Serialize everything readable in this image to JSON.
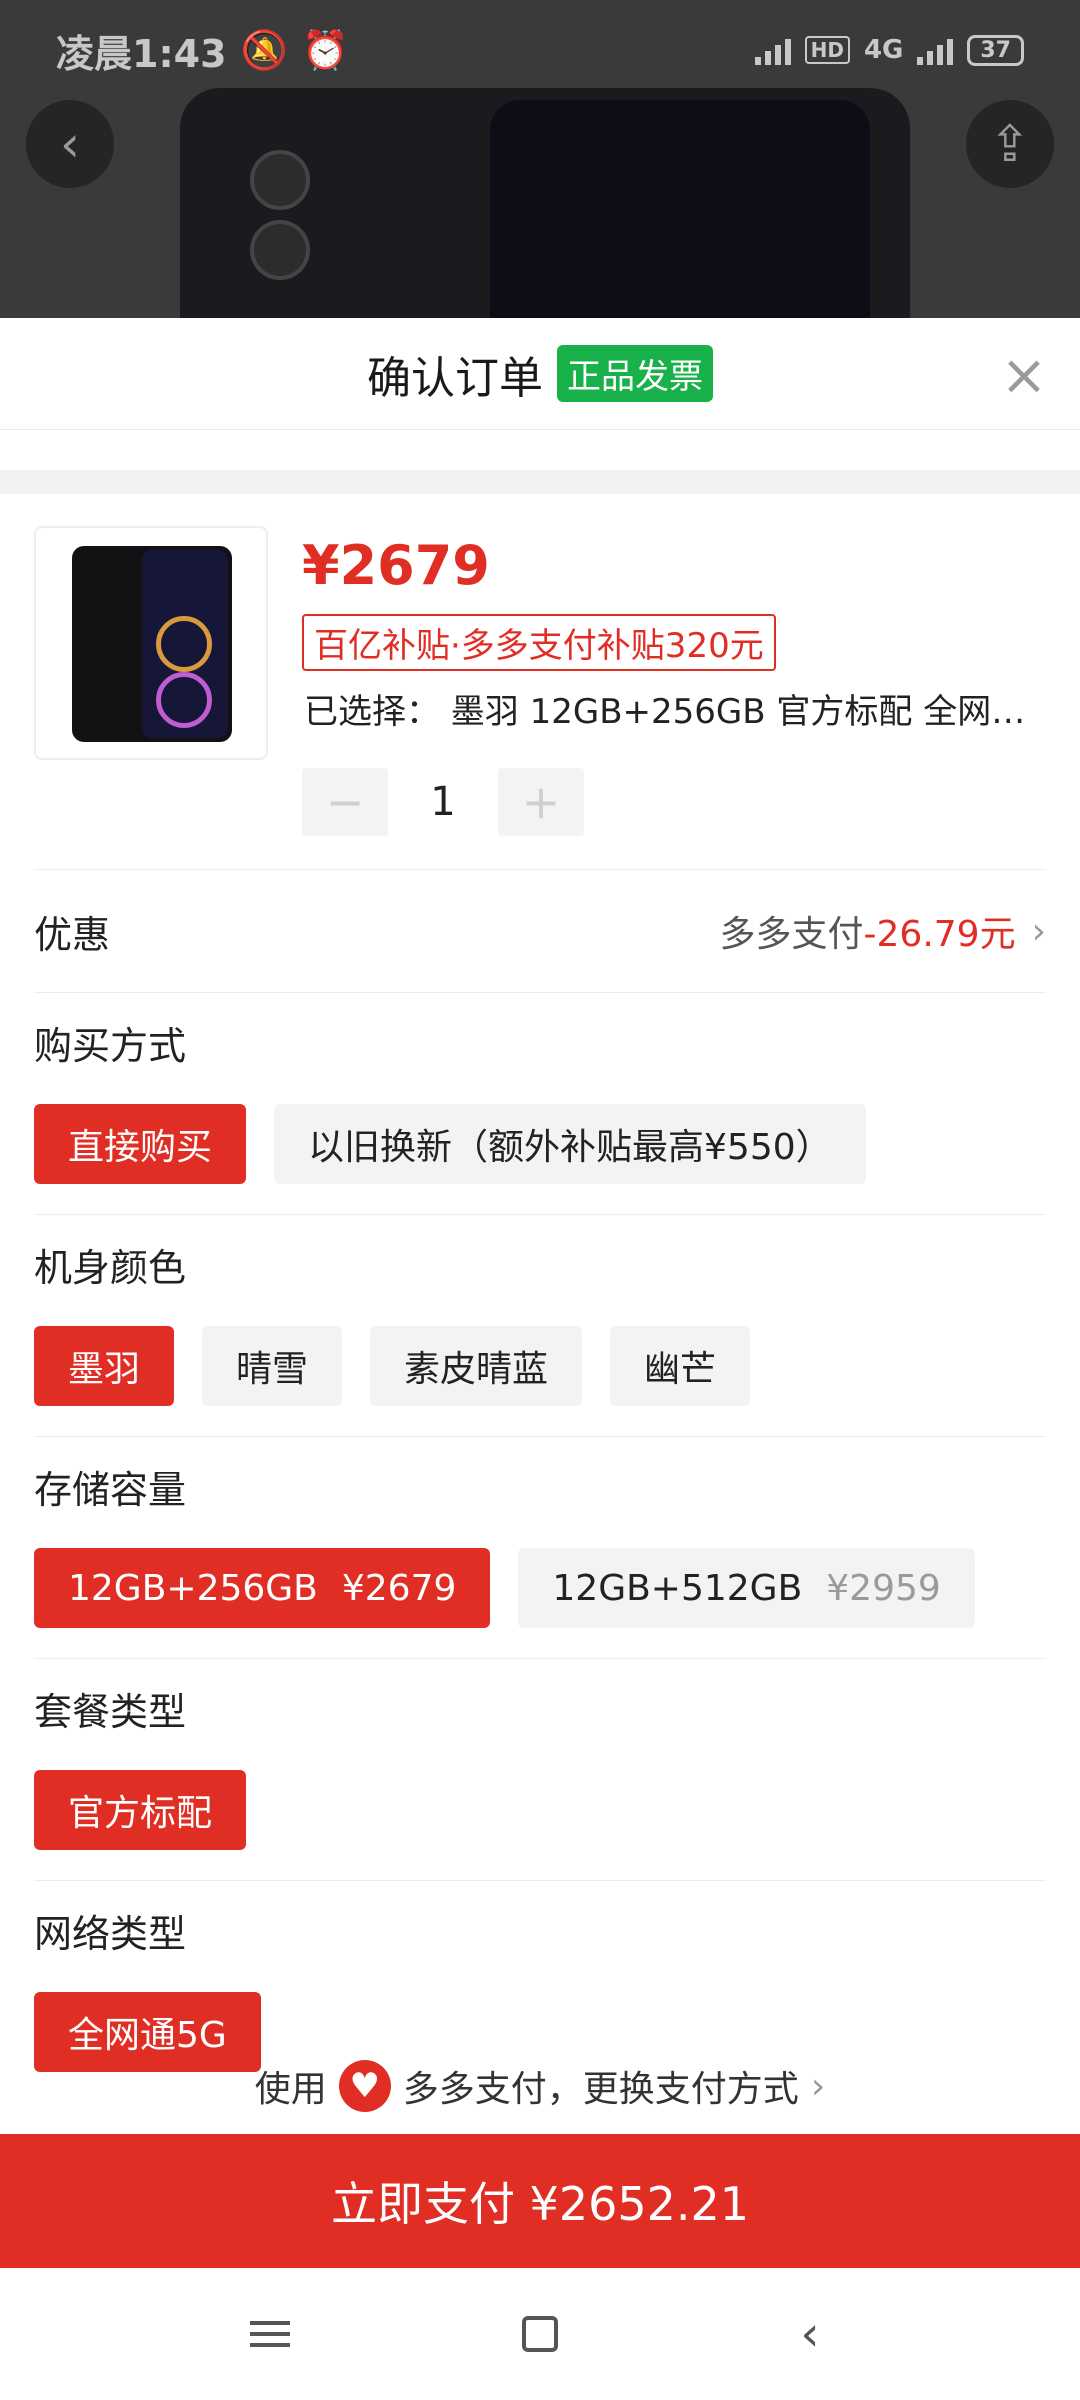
{
  "status_bar": {
    "time": "凌晨1:43",
    "hd": "HD",
    "network": "4G",
    "battery": "37"
  },
  "top_actions": {
    "back_icon": "chevron-left-icon",
    "share_icon": "share-icon"
  },
  "sheet": {
    "title": "确认订单",
    "badge": "正品发票",
    "close": "×"
  },
  "product": {
    "price": "¥2679",
    "subsidy": "百亿补贴·多多支付补贴320元",
    "selected": "已选择：  墨羽 12GB+256GB 官方标配 全网通5G",
    "quantity": "1",
    "minus": "−",
    "plus": "+"
  },
  "discount": {
    "label": "优惠",
    "method": "多多支付",
    "amount": "-26.79元"
  },
  "purchase_method": {
    "title": "购买方式",
    "options": [
      "直接购买",
      "以旧换新（额外补贴最高¥550）"
    ],
    "selected_index": 0
  },
  "color": {
    "title": "机身颜色",
    "options": [
      "墨羽",
      "晴雪",
      "素皮晴蓝",
      "幽芒"
    ],
    "selected_index": 0
  },
  "storage": {
    "title": "存储容量",
    "options": [
      {
        "name": "12GB+256GB",
        "price": "¥2679"
      },
      {
        "name": "12GB+512GB",
        "price": "¥2959"
      }
    ],
    "selected_index": 0
  },
  "package": {
    "title": "套餐类型",
    "options": [
      "官方标配"
    ],
    "selected_index": 0
  },
  "network_type": {
    "title": "网络类型",
    "options": [
      "全网通5G"
    ],
    "selected_index": 0
  },
  "payment": {
    "prefix": "使用",
    "method": "多多支付，更换支付方式",
    "button": "立即支付 ¥2652.21"
  },
  "colors": {
    "accent": "#e02e24",
    "badge_green": "#19b24a"
  }
}
